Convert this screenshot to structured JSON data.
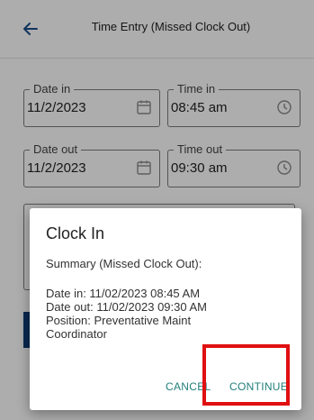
{
  "header": {
    "back_icon": "arrow-left-icon",
    "title": "Time Entry (Missed Clock Out)"
  },
  "form": {
    "date_in": {
      "label": "Date in",
      "value": "11/2/2023",
      "icon": "calendar-icon"
    },
    "time_in": {
      "label": "Time in",
      "value": "08:45 am",
      "icon": "clock-icon"
    },
    "date_out": {
      "label": "Date out",
      "value": "11/2/2023",
      "icon": "calendar-icon"
    },
    "time_out": {
      "label": "Time out",
      "value": "09:30 am",
      "icon": "clock-icon"
    }
  },
  "dialog": {
    "title": "Clock In",
    "subtitle": "Summary (Missed Clock Out):",
    "line_date_in": "Date in: 11/02/2023 08:45 AM",
    "line_date_out": "Date out: 11/02/2023 09:30 AM",
    "line_position_1": "Position: Preventative Maint",
    "line_position_2": "Coordinator",
    "cancel_label": "CANCEL",
    "continue_label": "CONTINUE"
  },
  "colors": {
    "accent": "#1f7f7a",
    "primary": "#0f3c73",
    "highlight": "#e01010"
  }
}
